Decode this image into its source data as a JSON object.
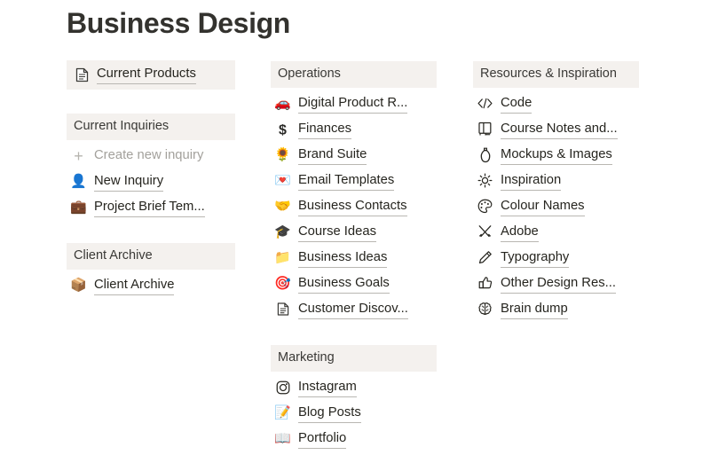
{
  "page": {
    "title": "Business Design",
    "background": "#ffffff",
    "header_band_color": "#f4f1ee",
    "text_color": "#26251f"
  },
  "columns": {
    "left": {
      "blocks": [
        {
          "name": "current-products",
          "header": {
            "label": "Current Products",
            "icon": "page-document-icon",
            "is_link": true
          },
          "items": []
        },
        {
          "name": "current-inquiries",
          "header": {
            "label": "Current Inquiries",
            "icon": null,
            "is_link": false
          },
          "items": [
            {
              "label": "Create new inquiry",
              "icon": "plus-icon",
              "muted": true
            },
            {
              "label": "New Inquiry",
              "icon": "bust-in-silhouette-emoji",
              "muted": false
            },
            {
              "label": "Project Brief Tem...",
              "icon": "briefcase-emoji",
              "muted": false
            }
          ]
        },
        {
          "name": "client-archive",
          "header": {
            "label": "Client Archive",
            "icon": null,
            "is_link": false
          },
          "items": [
            {
              "label": "Client Archive",
              "icon": "package-emoji",
              "muted": false
            }
          ]
        }
      ]
    },
    "middle": {
      "blocks": [
        {
          "name": "operations",
          "header": {
            "label": "Operations",
            "icon": null,
            "is_link": false
          },
          "items": [
            {
              "label": "Digital Product R...",
              "icon": "red-car-emoji",
              "muted": false
            },
            {
              "label": "Finances",
              "icon": "dollar-sign-icon",
              "muted": false
            },
            {
              "label": "Brand Suite",
              "icon": "sunflower-emoji",
              "muted": false
            },
            {
              "label": "Email Templates",
              "icon": "love-letter-emoji",
              "muted": false
            },
            {
              "label": "Business Contacts",
              "icon": "handshake-emoji",
              "muted": false
            },
            {
              "label": "Course Ideas",
              "icon": "graduation-cap-emoji",
              "muted": false
            },
            {
              "label": "Business Ideas",
              "icon": "folder-emoji",
              "muted": false
            },
            {
              "label": "Business Goals",
              "icon": "dart-target-emoji",
              "muted": false
            },
            {
              "label": "Customer Discov...",
              "icon": "page-document-icon",
              "muted": false
            }
          ]
        },
        {
          "name": "marketing",
          "header": {
            "label": "Marketing",
            "icon": null,
            "is_link": false
          },
          "items": [
            {
              "label": "Instagram",
              "icon": "instagram-camera-icon",
              "muted": false
            },
            {
              "label": "Blog Posts",
              "icon": "memo-pencil-emoji",
              "muted": false
            },
            {
              "label": "Portfolio",
              "icon": "open-book-emoji",
              "muted": false
            }
          ]
        }
      ]
    },
    "right": {
      "blocks": [
        {
          "name": "resources-and-inspiration",
          "header": {
            "label": "Resources & Inspiration",
            "icon": null,
            "is_link": false
          },
          "items": [
            {
              "label": "Code",
              "icon": "code-brackets-icon",
              "muted": false
            },
            {
              "label": "Course Notes and...",
              "icon": "notebook-icon",
              "muted": false
            },
            {
              "label": "Mockups & Images",
              "icon": "bottle-mockup-icon",
              "muted": false
            },
            {
              "label": "Inspiration",
              "icon": "sun-light-icon",
              "muted": false
            },
            {
              "label": "Colour Names",
              "icon": "paint-palette-icon",
              "muted": false
            },
            {
              "label": "Adobe",
              "icon": "crossed-brushes-icon",
              "muted": false
            },
            {
              "label": "Typography",
              "icon": "pencil-icon",
              "muted": false
            },
            {
              "label": "Other Design Res...",
              "icon": "thumbs-up-icon",
              "muted": false
            },
            {
              "label": "Brain dump",
              "icon": "brain-icon",
              "muted": false
            }
          ]
        }
      ]
    }
  }
}
